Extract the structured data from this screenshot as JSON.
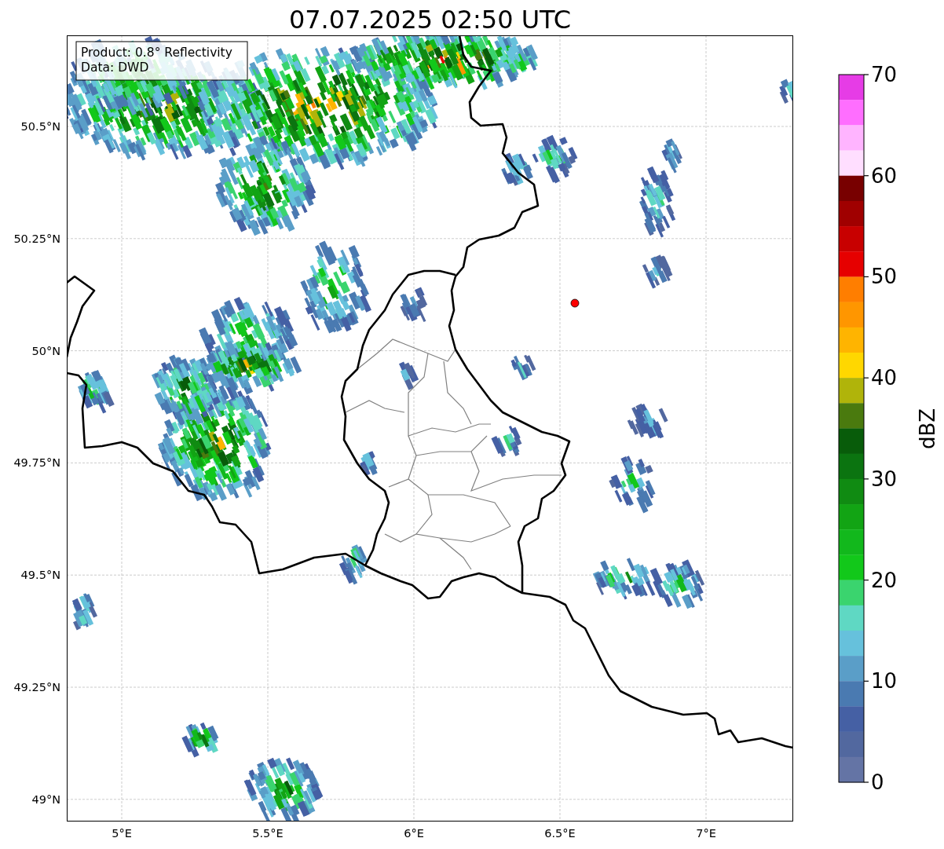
{
  "title": "07.07.2025 02:50 UTC",
  "annotation": [
    "Product: 0.8° Reflectivity",
    "Data: DWD"
  ],
  "lat_labels": [
    "50.5°N",
    "50.25°N",
    "50°N",
    "49.75°N",
    "49.5°N",
    "49.25°N",
    "49°N"
  ],
  "lon_labels": [
    "5°E",
    "5.5°E",
    "6°E",
    "6.5°E",
    "7°E"
  ],
  "colorbar": {
    "label": "dBZ",
    "ticks": [
      "70",
      "60",
      "50",
      "40",
      "30",
      "20",
      "10",
      "0"
    ],
    "bins": [
      {
        "color": "#e63ce6"
      },
      {
        "color": "#ff6eff"
      },
      {
        "color": "#ffb4ff"
      },
      {
        "color": "#ffdeff"
      },
      {
        "color": "#780000"
      },
      {
        "color": "#a00000"
      },
      {
        "color": "#c80000"
      },
      {
        "color": "#e60000"
      },
      {
        "color": "#ff7e00"
      },
      {
        "color": "#ff9600"
      },
      {
        "color": "#ffb400"
      },
      {
        "color": "#ffd700"
      },
      {
        "color": "#b0b40a"
      },
      {
        "color": "#4a7a0e"
      },
      {
        "color": "#085c0a"
      },
      {
        "color": "#0b7410"
      },
      {
        "color": "#108b12"
      },
      {
        "color": "#12a414"
      },
      {
        "color": "#12b81c"
      },
      {
        "color": "#12c81a"
      },
      {
        "color": "#3ad46e"
      },
      {
        "color": "#5fd8c3"
      },
      {
        "color": "#66c1dc"
      },
      {
        "color": "#5a9ec8"
      },
      {
        "color": "#4a7ab1"
      },
      {
        "color": "#4560a4"
      },
      {
        "color": "#52689f"
      },
      {
        "color": "#6474a5"
      }
    ]
  }
}
